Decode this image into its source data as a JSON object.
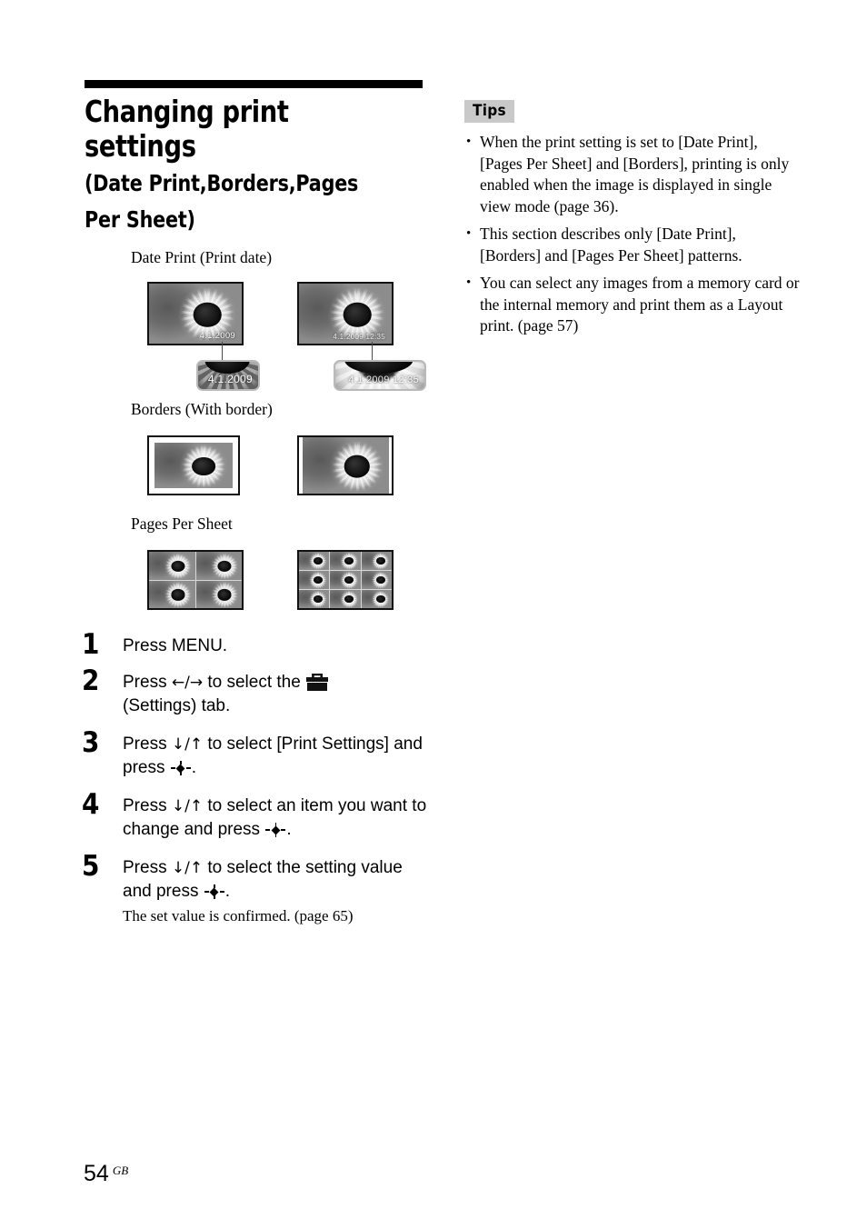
{
  "page": {
    "number": "54",
    "region": "GB"
  },
  "heading": {
    "title": "Changing print settings",
    "subtitle": "(Date Print,Borders,Pages Per Sheet)"
  },
  "samples": [
    {
      "label": "Date Print (Print date)",
      "variants": [
        {
          "date_overlay": "4.1.2009",
          "callout_text": "4.1.2009"
        },
        {
          "date_overlay": "4.1.2009  12:35",
          "callout_text": "4.1.2009  12:35"
        }
      ]
    },
    {
      "label": "Borders (With border)",
      "variants": [
        {
          "style": "with-border"
        },
        {
          "style": "no-border"
        }
      ]
    },
    {
      "label": "Pages Per Sheet",
      "variants": [
        {
          "grid": "2x2"
        },
        {
          "grid": "3x3"
        }
      ]
    }
  ],
  "steps": [
    {
      "number": "1",
      "text_parts": [
        "Press MENU."
      ]
    },
    {
      "number": "2",
      "before": "Press ",
      "arrows": "←/→",
      "middle": " to select the ",
      "icon": "toolbox-icon",
      "after": "(Settings) tab."
    },
    {
      "number": "3",
      "before": "Press ",
      "arrows": "↓/↑",
      "middle": " to select [Print Settings] and press ",
      "icon": "enter-icon",
      "after": "."
    },
    {
      "number": "4",
      "before": "Press ",
      "arrows": "↓/↑",
      "middle": " to select an item you want to change and press ",
      "icon": "enter-icon",
      "after": "."
    },
    {
      "number": "5",
      "before": "Press ",
      "arrows": "↓/↑",
      "middle": " to select the setting value and press ",
      "icon": "enter-icon",
      "after": ".",
      "sub": "The set value is confirmed. (page 65)"
    }
  ],
  "tips": {
    "label": "Tips",
    "items": [
      "When the print setting is set to [Date Print], [Pages Per Sheet] and [Borders], printing is only enabled when the image is displayed in single view mode (page 36).",
      "This section describes only [Date Print], [Borders] and [Pages Per Sheet] patterns.",
      "You can select any images from a memory card or the internal memory and print them  as a Layout print. (page 57)"
    ]
  },
  "colors": {
    "tips_badge_bg": "#c9c9c9",
    "rule": "#000000",
    "callout_border": "#b9b9b9"
  }
}
